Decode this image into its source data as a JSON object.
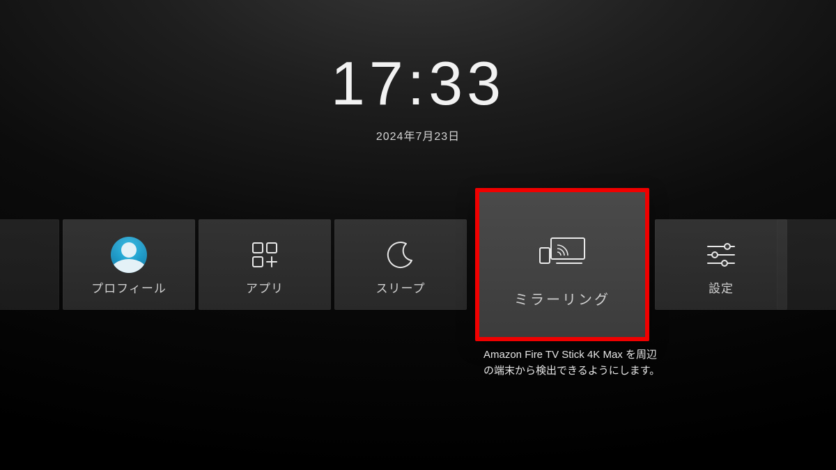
{
  "clock": {
    "time": "17:33",
    "date": "2024年7月23日"
  },
  "tiles": {
    "profile": {
      "label": "プロフィール",
      "icon": "profile-avatar-icon"
    },
    "apps": {
      "label": "アプリ",
      "icon": "apps-grid-icon"
    },
    "sleep": {
      "label": "スリープ",
      "icon": "moon-icon"
    },
    "mirroring": {
      "label": "ミラーリング",
      "icon": "screen-mirroring-icon"
    },
    "settings": {
      "label": "設定",
      "icon": "sliders-icon"
    }
  },
  "focused_tile": "mirroring",
  "description": {
    "line1": "Amazon Fire TV Stick 4K Max",
    "line2": "を周辺の端末から検出できるようにします。"
  },
  "colors": {
    "highlight": "#f00000",
    "avatar_bg": "#1893c2"
  }
}
